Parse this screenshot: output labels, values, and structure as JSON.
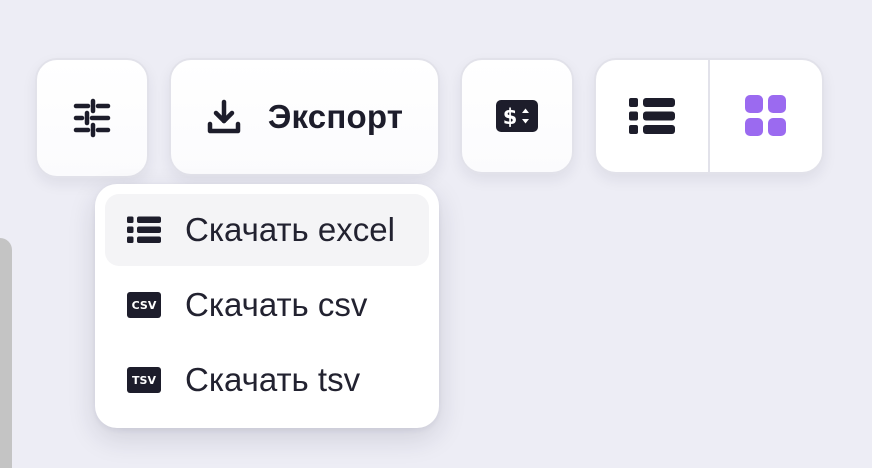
{
  "toolbar": {
    "filter_icon": "sliders-icon",
    "export": {
      "label": "Экспорт",
      "icon": "download-icon"
    },
    "currency_icon": "currency-card-icon",
    "view_toggle": {
      "list_icon": "list-view-icon",
      "grid_icon": "grid-view-icon",
      "active": "grid",
      "accent": "#9b6af0"
    }
  },
  "export_menu": {
    "items": [
      {
        "label": "Скачать excel",
        "icon": "list-icon",
        "highlighted": true
      },
      {
        "label": "Скачать csv",
        "icon": "csv-file-icon",
        "badge": "CSV"
      },
      {
        "label": "Скачать tsv",
        "icon": "tsv-file-icon",
        "badge": "TSV"
      }
    ]
  }
}
